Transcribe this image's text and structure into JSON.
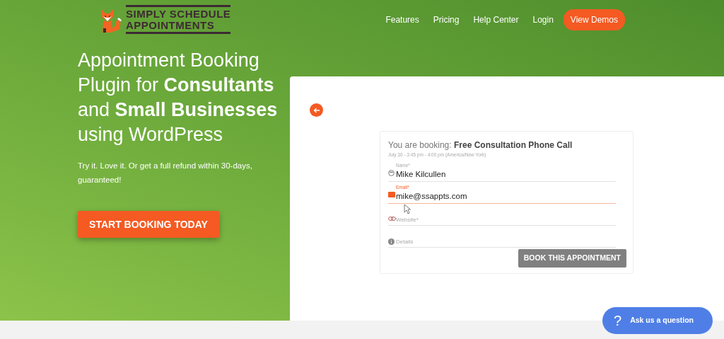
{
  "logo": {
    "lines": [
      "SIMPLY SCHEDULE",
      "APPOINTMENTS"
    ]
  },
  "nav": [
    {
      "label": "Features",
      "kind": "link"
    },
    {
      "label": "Pricing",
      "kind": "link"
    },
    {
      "label": "Help Center",
      "kind": "link"
    },
    {
      "label": "Login",
      "kind": "link"
    },
    {
      "label": "View Demos",
      "kind": "cta"
    }
  ],
  "hero": {
    "heading": "Appointment Booking Plugin for **Consultants** and **Small Businesses** using WordPress",
    "subtext": "Try it. Love it. Or get a full refund within 30-days, guaranteed!",
    "button": "START BOOKING TODAY"
  },
  "booking": {
    "prefix": "You are booking:",
    "title": "Free Consultation Phone Call",
    "when": "July 30  -  3:45 pm - 4:00 pm (America/New York)",
    "fields": [
      {
        "kind": "name",
        "label": "Name*",
        "value": "Mike Kilcullen",
        "focused": false
      },
      {
        "kind": "email",
        "label": "Email*",
        "value": "mike@ssappts.com",
        "focused": true
      },
      {
        "kind": "url",
        "label": "Website*",
        "focused": false
      },
      {
        "kind": "text",
        "label": "Details",
        "focused": false
      }
    ],
    "button": "BOOK THIS APPOINTMENT"
  },
  "chat": {
    "icon": "?",
    "label": "Ask us a question"
  }
}
